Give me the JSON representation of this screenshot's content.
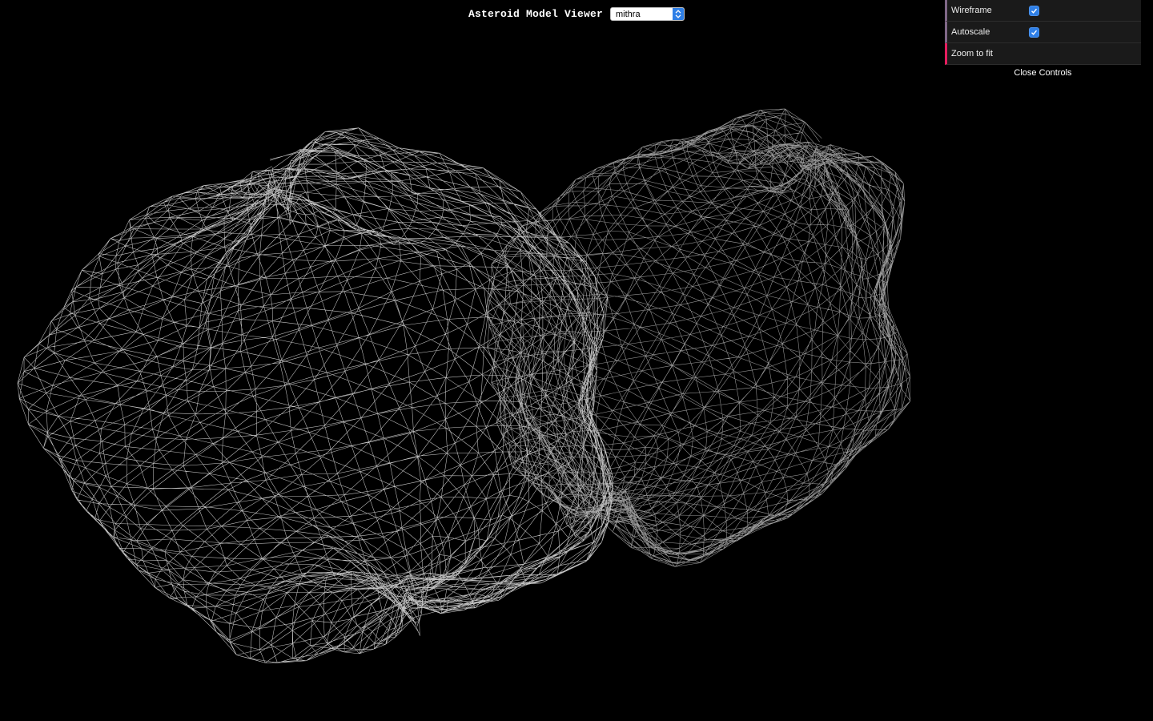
{
  "header": {
    "title": "Asteroid Model Viewer",
    "model_select": {
      "value": "mithra"
    }
  },
  "controls": {
    "items": [
      {
        "label": "Wireframe",
        "type": "checkbox",
        "checked": true
      },
      {
        "label": "Autoscale",
        "type": "checkbox",
        "checked": true
      },
      {
        "label": "Zoom to fit",
        "type": "function"
      }
    ],
    "close_label": "Close Controls"
  },
  "viewport": {
    "mode": "wireframe",
    "background": "#000000",
    "mesh_color": "#bdbdbd"
  },
  "colors": {
    "accent": "#2f7fe6",
    "boolean_marker": "#806787",
    "function_marker": "#e61d5f",
    "panel_bg": "#1a1a1a"
  }
}
